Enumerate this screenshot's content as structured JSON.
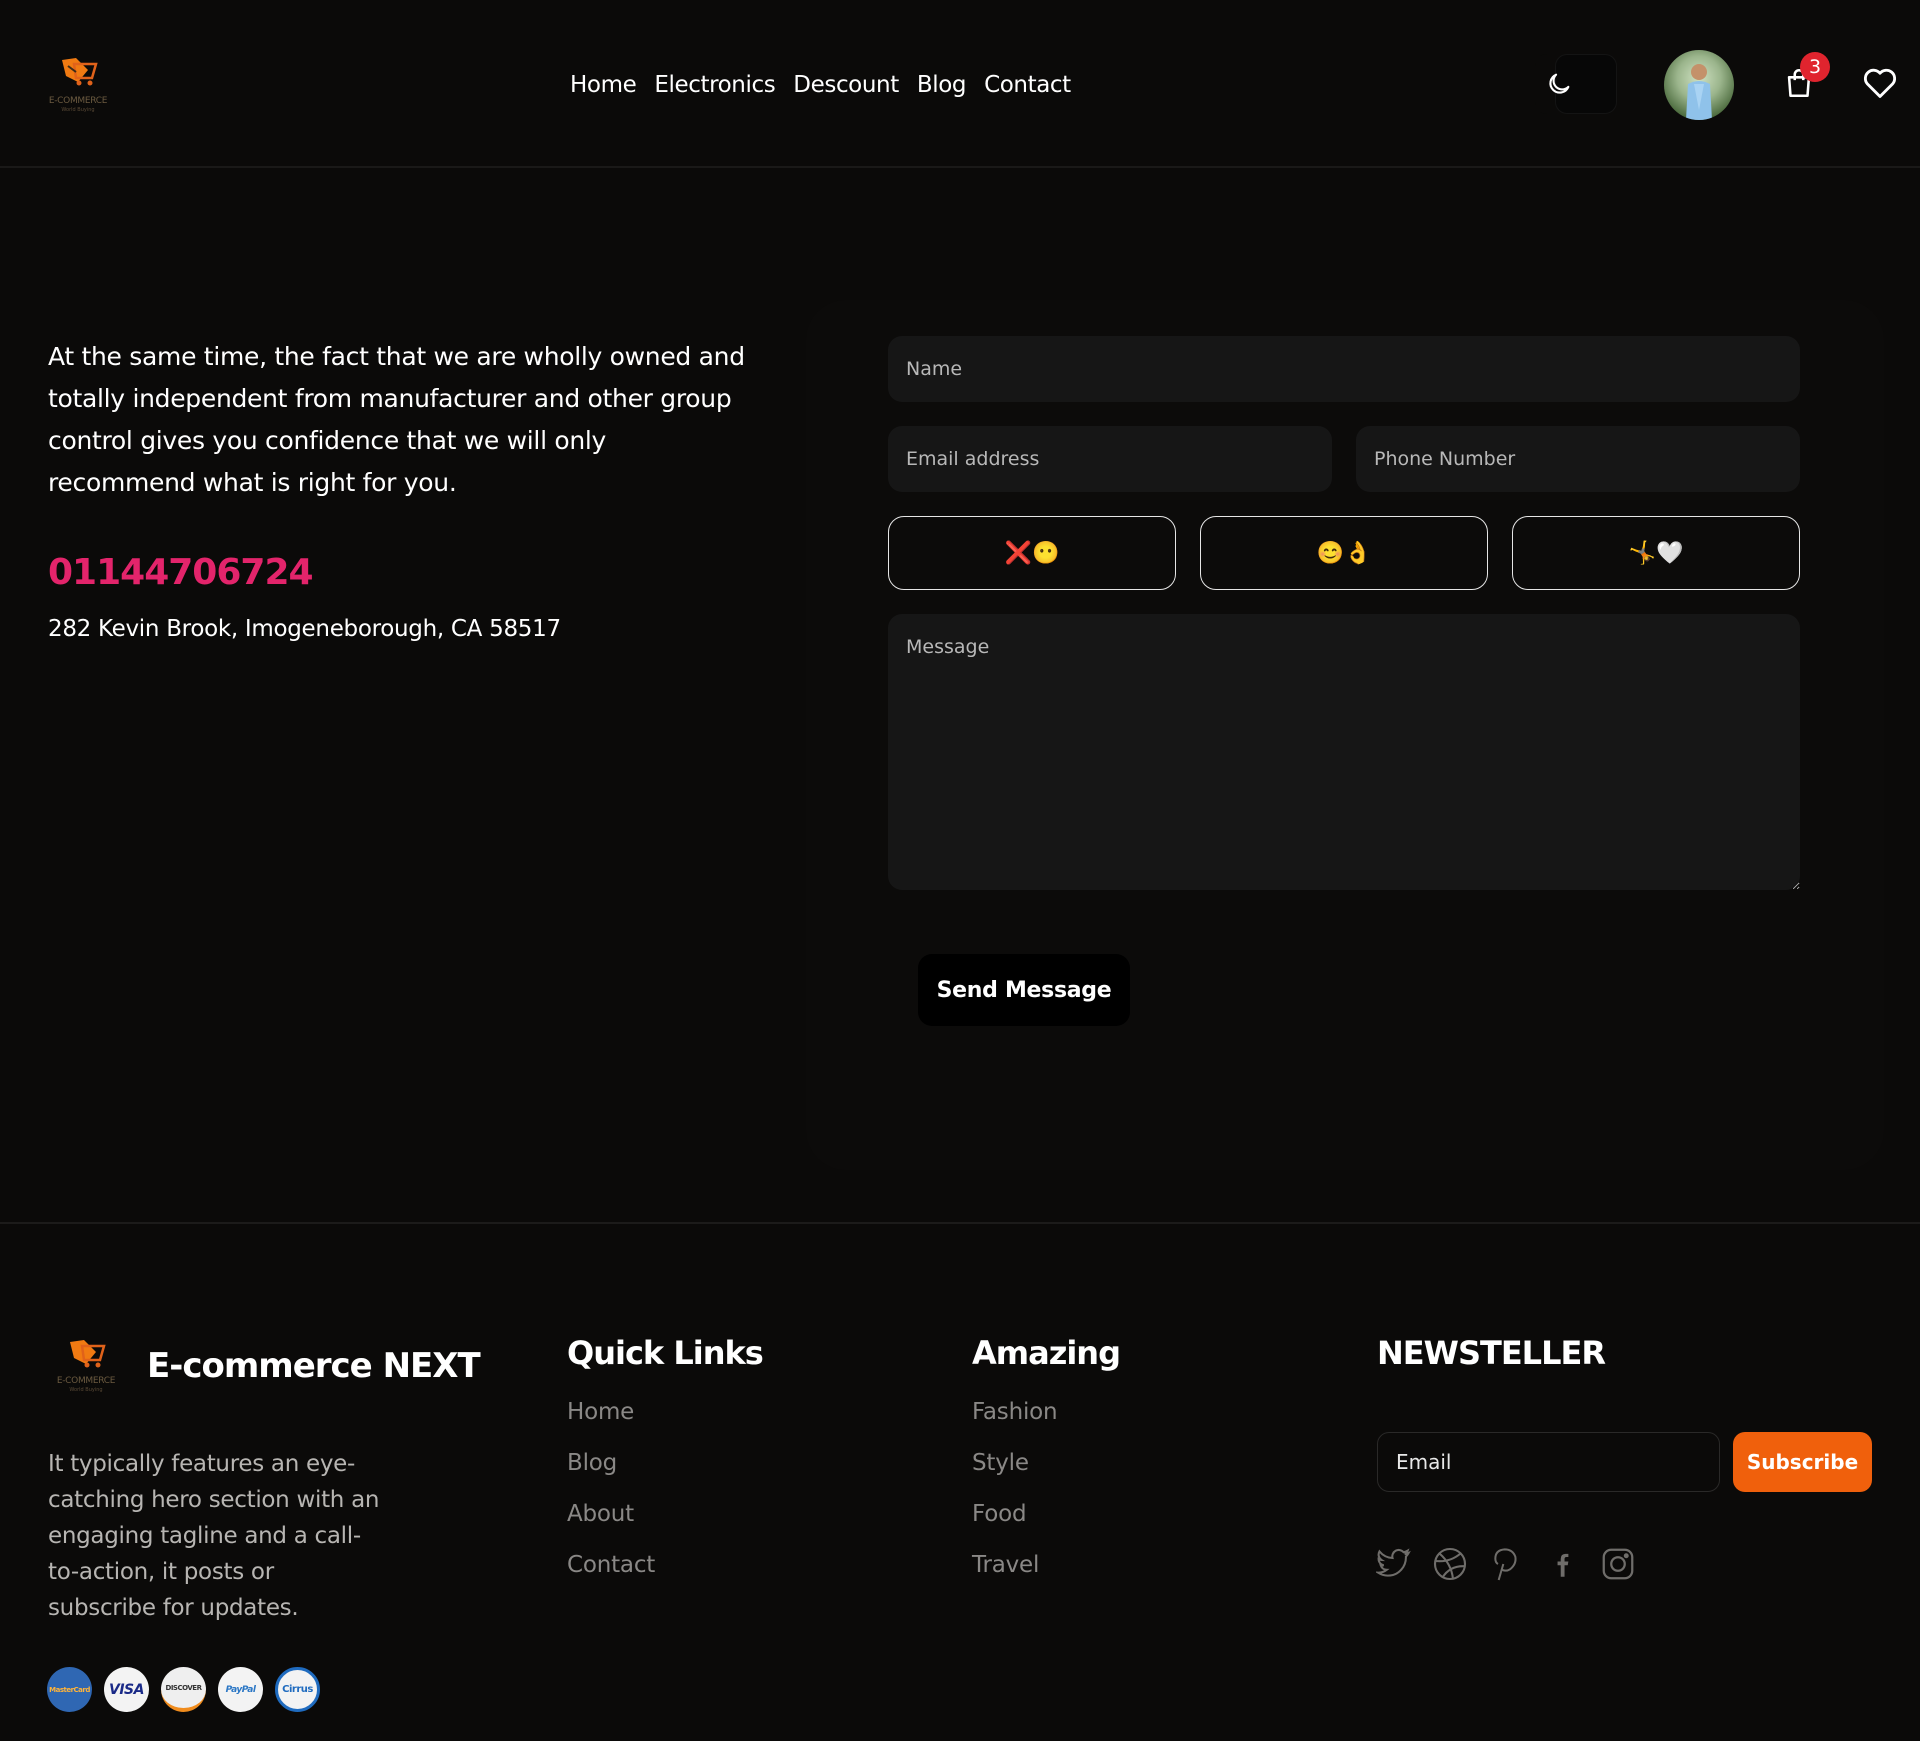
{
  "header": {
    "logo_text": "E-COMMERCE",
    "logo_sub": "World Buying",
    "nav": [
      "Home",
      "Electronics",
      "Descount",
      "Blog",
      "Contact"
    ],
    "cart_count": "3"
  },
  "contact": {
    "intro": "At the same time, the fact that we are wholly owned and totally independent from manufacturer and other group control gives you confidence that we will only recommend what is right for you.",
    "phone": "01144706724",
    "address": "282 Kevin Brook, Imogeneborough, CA 58517"
  },
  "form": {
    "name_placeholder": "Name",
    "email_placeholder": "Email address",
    "phone_placeholder": "Phone Number",
    "message_placeholder": "Message",
    "choices": [
      {
        "emoji": "❌😶"
      },
      {
        "emoji": "😊👌"
      },
      {
        "emoji": "🤸🤍"
      }
    ],
    "send_label": "Send Message"
  },
  "footer": {
    "brand": "E-commerce NEXT",
    "logo_text": "E-COMMERCE",
    "logo_sub": "World Buying",
    "description": "It typically features an eye-catching hero section with an engaging tagline and a call-to-action, it posts or subscribe for updates.",
    "quick_links": {
      "title": "Quick Links",
      "items": [
        "Home",
        "Blog",
        "About",
        "Contact"
      ]
    },
    "amazing": {
      "title": "Amazing",
      "items": [
        "Fashion",
        "Style",
        "Food",
        "Travel"
      ]
    },
    "newsletter": {
      "title": "NEWSTELLER",
      "email_placeholder": "Email",
      "subscribe_label": "Subscribe"
    },
    "socials": [
      "twitter-icon",
      "dribbble-icon",
      "pinterest-icon",
      "facebook-icon",
      "instagram-icon"
    ],
    "payments": [
      {
        "name": "mastercard-icon",
        "label": "MasterCard"
      },
      {
        "name": "visa-icon",
        "label": "VISA"
      },
      {
        "name": "discover-icon",
        "label": "DISCOVER"
      },
      {
        "name": "paypal-icon",
        "label": "PayPal"
      },
      {
        "name": "cirrus-icon",
        "label": "Cirrus"
      }
    ]
  },
  "colors": {
    "background": "#0b0a09",
    "phone_accent": "#e3246b",
    "subscribe_accent": "#f0600c",
    "badge": "#e0242e"
  }
}
